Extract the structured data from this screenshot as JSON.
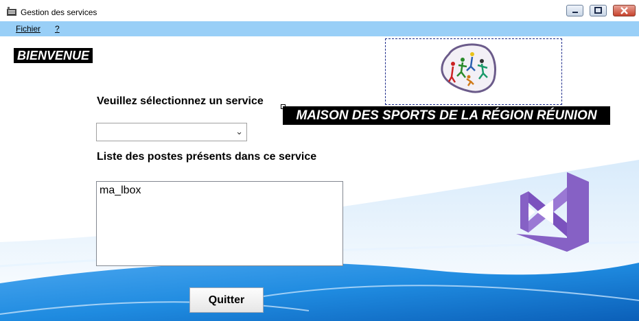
{
  "window": {
    "title": "Gestion des services",
    "controls": [
      "minimize-icon",
      "maximize-icon",
      "close-icon"
    ]
  },
  "menu": {
    "items": [
      {
        "label": "Fichier"
      },
      {
        "label": "?"
      }
    ]
  },
  "main": {
    "welcome": "BIENVENUE",
    "banner": "MAISON DES SPORTS DE LA RÉGION RÉUNION",
    "select_label": "Veuillez sélectionnez un service",
    "service_combo_value": "",
    "list_label": "Liste des postes présents dans ce service",
    "listbox_text": "ma_lbox",
    "quit_button": "Quitter"
  },
  "colors": {
    "menubar": "#99cff7",
    "banner_bg": "#000000",
    "vs_purple": "#8661c5",
    "wave_blue": "#1f8be0"
  }
}
